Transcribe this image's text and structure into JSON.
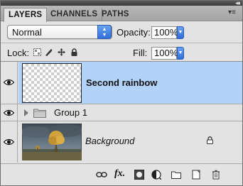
{
  "panel": {
    "collapse_glyph": "◂◂",
    "menu_glyph": "▾≡"
  },
  "tabs": [
    {
      "label": "LAYERS",
      "active": true
    },
    {
      "label": "CHANNELS",
      "active": false
    },
    {
      "label": "PATHS",
      "active": false
    }
  ],
  "blend": {
    "mode": "Normal",
    "opacity_label": "Opacity:",
    "opacity_value": "100%"
  },
  "lock": {
    "label": "Lock:",
    "icons": [
      "lock-transparent-pixels-icon",
      "lock-image-pixels-icon",
      "lock-position-icon",
      "lock-all-icon"
    ],
    "fill_label": "Fill:",
    "fill_value": "100%"
  },
  "layers": [
    {
      "name": "Second rainbow",
      "selected": true,
      "type": "pixel",
      "thumbnail": "transparent",
      "visible": true
    },
    {
      "name": "Group 1",
      "selected": false,
      "type": "group",
      "visible": true
    },
    {
      "name": "Background",
      "selected": false,
      "type": "pixel",
      "thumbnail": "landscape-tree-photo",
      "visible": true,
      "locked": true
    }
  ],
  "toolbar_icons": [
    "link-layers-icon",
    "fx-icon",
    "layer-mask-icon",
    "adjustment-layer-icon",
    "new-group-icon",
    "new-layer-icon",
    "trash-icon"
  ],
  "toolbar_fx_text": "fx."
}
